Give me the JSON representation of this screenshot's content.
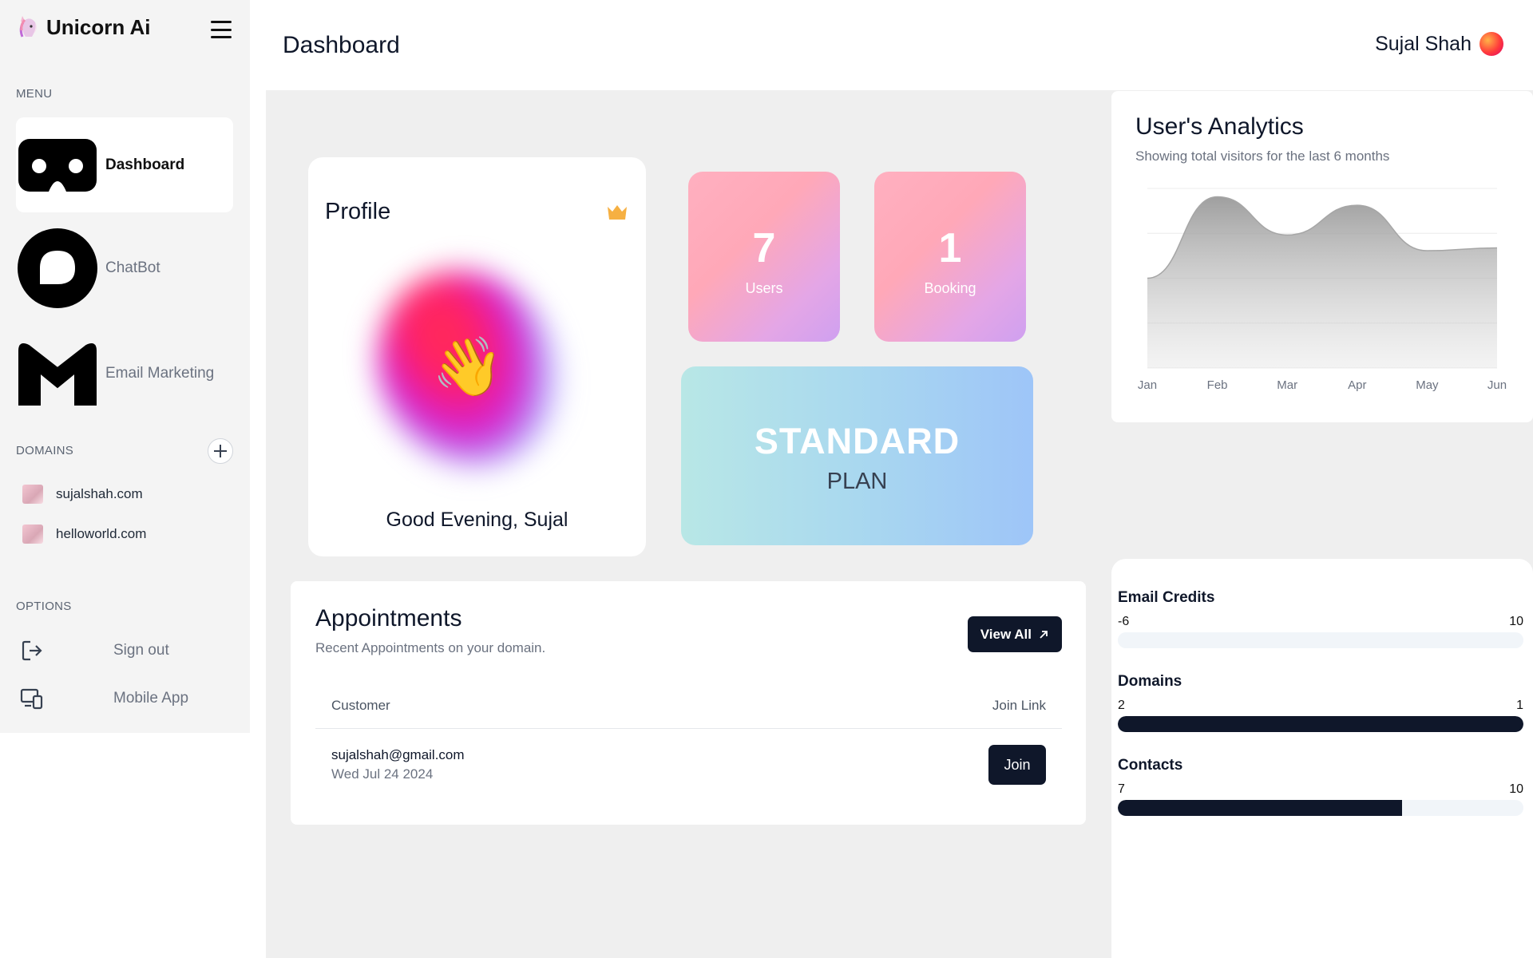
{
  "brand": {
    "name": "Unicorn Ai",
    "logo_icon": "unicorn-icon"
  },
  "sidebar": {
    "menu_label": "MENU",
    "menu": [
      {
        "label": "Dashboard",
        "icon": "vr-headset-icon",
        "active": true
      },
      {
        "label": "ChatBot",
        "icon": "chat-bubble-icon",
        "active": false
      },
      {
        "label": "Email Marketing",
        "icon": "gmail-icon",
        "active": false
      }
    ],
    "domains_label": "DOMAINS",
    "domains": [
      {
        "label": "sujalshah.com"
      },
      {
        "label": "helloworld.com"
      }
    ],
    "options_label": "OPTIONS",
    "options": [
      {
        "label": "Sign out",
        "icon": "sign-out-icon"
      },
      {
        "label": "Mobile App",
        "icon": "devices-icon"
      }
    ]
  },
  "header": {
    "title": "Dashboard",
    "user_name": "Sujal Shah"
  },
  "profile": {
    "title": "Profile",
    "greeting": "Good Evening, Sujal",
    "emoji": "👋"
  },
  "stats": [
    {
      "value": "7",
      "label": "Users"
    },
    {
      "value": "1",
      "label": "Booking"
    }
  ],
  "plan": {
    "name": "STANDARD",
    "sub": "PLAN"
  },
  "analytics": {
    "title": "User's Analytics",
    "subtitle": "Showing total visitors for the last 6 months"
  },
  "chart_data": {
    "type": "area",
    "categories": [
      "Jan",
      "Feb",
      "Mar",
      "Apr",
      "May",
      "Jun"
    ],
    "values": [
      160,
      305,
      237,
      290,
      209,
      214
    ],
    "ylim": [
      0,
      320
    ],
    "grid": true,
    "fill_color": "#a6a6a6"
  },
  "appointments": {
    "title": "Appointments",
    "subtitle": "Recent Appointments on your domain.",
    "view_all_label": "View All",
    "columns": [
      "Customer",
      "Join Link"
    ],
    "rows": [
      {
        "email": "sujalshah@gmail.com",
        "date": "Wed Jul 24 2024",
        "action": "Join"
      }
    ]
  },
  "usage": [
    {
      "title": "Email Credits",
      "current": "-6",
      "max": "10",
      "fraction": 0
    },
    {
      "title": "Domains",
      "current": "2",
      "max": "1",
      "fraction": 1
    },
    {
      "title": "Contacts",
      "current": "7",
      "max": "10",
      "fraction": 0.7
    }
  ],
  "colors": {
    "dark": "#0f172a",
    "muted": "#6b7280",
    "background": "#efefef"
  }
}
